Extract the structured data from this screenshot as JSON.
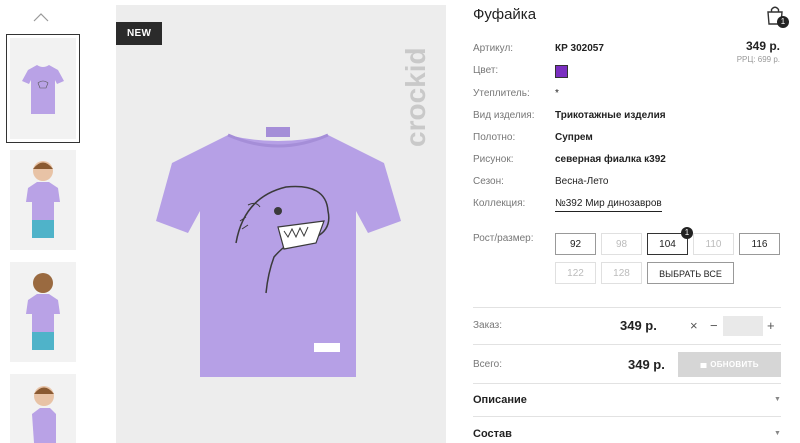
{
  "product": {
    "title": "Фуфайка",
    "badge": "NEW",
    "brand_logo": "crockid",
    "price": "349 р.",
    "rrp": "РРЦ: 699 р.",
    "cart_count": "1",
    "color_hex": "#7a2fc0"
  },
  "attrs": [
    {
      "label": "Артикул:",
      "value": "КР 302057"
    },
    {
      "label": "Цвет:",
      "value": ""
    },
    {
      "label": "Утеплитель:",
      "value": "*"
    },
    {
      "label": "Вид изделия:",
      "value": "Трикотажные изделия"
    },
    {
      "label": "Полотно:",
      "value": "Супрем"
    },
    {
      "label": "Рисунок:",
      "value": "северная фиалка к392"
    },
    {
      "label": "Сезон:",
      "value": "Весна-Лето"
    },
    {
      "label": "Коллекция:",
      "value": "№392 Мир динозавров"
    }
  ],
  "sizes": {
    "label": "Рост/размер:",
    "items": [
      "92",
      "98",
      "104",
      "110",
      "116",
      "122",
      "128"
    ],
    "selected_count": "1",
    "select_all": "ВЫБРАТЬ ВСЕ"
  },
  "order": {
    "label": "Заказ:",
    "price": "349 р.",
    "clear": "×",
    "minus": "−",
    "plus": "+",
    "quantity": ""
  },
  "total": {
    "label": "Всего:",
    "price": "349 р.",
    "update": "ОБНОВИТЬ"
  },
  "sections": [
    {
      "label": "Описание"
    },
    {
      "label": "Состав"
    }
  ]
}
